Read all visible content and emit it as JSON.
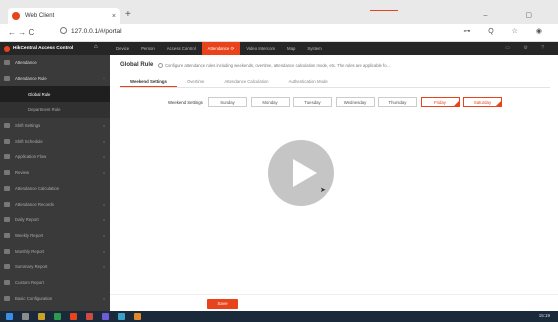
{
  "browser": {
    "tab_title": "Web Client",
    "tab_close": "×",
    "new_tab": "+",
    "nav": "←  →  C",
    "url": "127.0.0.1/#/portal",
    "window_controls": "–  ▢",
    "address_icons": "⊶ Q ☆ ◉"
  },
  "app": {
    "brand": "HikCentral Access Control",
    "home_icon": "⌂",
    "menu": [
      {
        "label": "Device"
      },
      {
        "label": "Person"
      },
      {
        "label": "Access Control"
      },
      {
        "label": "Attendance ⟳"
      },
      {
        "label": "Video Intercom"
      },
      {
        "label": "Map"
      },
      {
        "label": "System"
      }
    ],
    "header_icons": "▭ ⚙ ?"
  },
  "sidebar": {
    "items": [
      {
        "label": "Attendance",
        "kind": "group"
      },
      {
        "label": "Attendance Rule",
        "kind": "open"
      },
      {
        "label": "Global Rule",
        "kind": "sub-selected"
      },
      {
        "label": "Department Rule",
        "kind": "sub"
      },
      {
        "label": "Shift Settings",
        "kind": "item"
      },
      {
        "label": "Shift Schedule",
        "kind": "item"
      },
      {
        "label": "Application Flow",
        "kind": "item"
      },
      {
        "label": "Review",
        "kind": "item"
      },
      {
        "label": "Attendance Calculation",
        "kind": "item"
      },
      {
        "label": "Attendance Records",
        "kind": "item"
      },
      {
        "label": "Daily Report",
        "kind": "item"
      },
      {
        "label": "Weekly Report",
        "kind": "item"
      },
      {
        "label": "Monthly Report",
        "kind": "item"
      },
      {
        "label": "Summary Report",
        "kind": "item"
      },
      {
        "label": "Custom Report",
        "kind": "item"
      },
      {
        "label": "Basic Configuration",
        "kind": "item"
      }
    ]
  },
  "content": {
    "title": "Global Rule",
    "description": "Configure attendance rules including weekends, overtime, attendance calculation mode, etc. The rules are applicable fo...",
    "tabs": [
      "Weekend Settings",
      "Overtime",
      "Attendance Calculation",
      "Authentication Mode"
    ],
    "weekend_label": "Weekend Settings",
    "days": [
      {
        "label": "Sunday",
        "selected": false
      },
      {
        "label": "Monday",
        "selected": false
      },
      {
        "label": "Tuesday",
        "selected": false
      },
      {
        "label": "Wednesday",
        "selected": false
      },
      {
        "label": "Thursday",
        "selected": false
      },
      {
        "label": "Friday",
        "selected": true
      },
      {
        "label": "Saturday",
        "selected": true
      }
    ],
    "save_label": "Save"
  },
  "taskbar": {
    "time": "15:19"
  },
  "colors": {
    "accent": "#e8431a",
    "sidebar_bg": "#3a3a3a",
    "header_bg": "#262626"
  }
}
